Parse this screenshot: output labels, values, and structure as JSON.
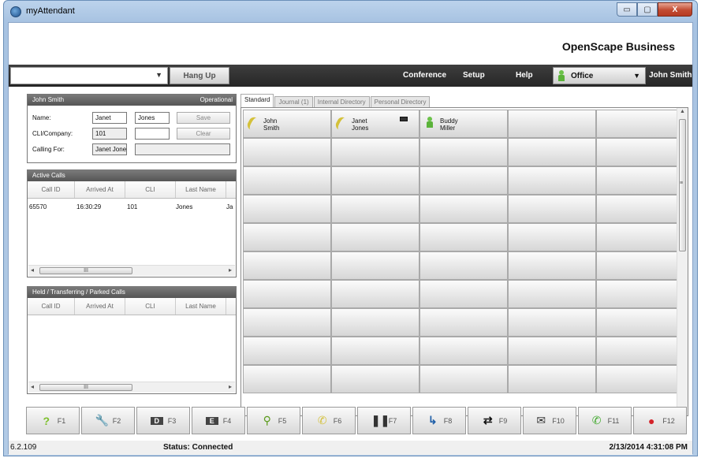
{
  "window": {
    "title": "myAttendant",
    "controls": {
      "minimize": "▭",
      "maximize": "▢",
      "close": "X"
    }
  },
  "brand": "OpenScape Business",
  "toolbar": {
    "hang_up": "Hang Up",
    "menu": [
      "Conference",
      "Setup",
      "Help"
    ],
    "presence": "Office",
    "user": "John Smith"
  },
  "caller_panel": {
    "header_name": "John Smith",
    "header_status": "Operational",
    "name_label": "Name:",
    "first_name": "Janet",
    "last_name": "Jones",
    "cli_label": "CLI/Company:",
    "cli": "101",
    "calling_for_label": "Calling For:",
    "calling_for": "Janet Jone",
    "save": "Save",
    "clear": "Clear"
  },
  "active_calls": {
    "title": "Active Calls",
    "columns": [
      "Call ID",
      "Arrived At",
      "CLI",
      "Last Name"
    ],
    "rows": [
      [
        "65570",
        "16:30:29",
        "101",
        "Jones",
        "Ja"
      ]
    ]
  },
  "held_calls": {
    "title": "Held / Transferring / Parked Calls",
    "columns": [
      "Call ID",
      "Arrived At",
      "CLI",
      "Last Name"
    ]
  },
  "tabs": [
    "Standard",
    "Journal (1)",
    "Internal Directory",
    "Personal Directory"
  ],
  "busy_lamp": [
    {
      "line1": "John",
      "line2": "Smith",
      "state": "on-call"
    },
    {
      "line1": "Janet",
      "line2": "Jones",
      "state": "on-call",
      "mail": true
    },
    {
      "line1": "Buddy",
      "line2": "Miller",
      "state": "available"
    }
  ],
  "fkeys": [
    {
      "label": "F1",
      "icon": "help-icon",
      "color": "#7cbf2a"
    },
    {
      "label": "F2",
      "icon": "wrench-icon",
      "color": "#444"
    },
    {
      "label": "F3",
      "icon": "d-key-icon",
      "color": "#444"
    },
    {
      "label": "F4",
      "icon": "e-key-icon",
      "color": "#444"
    },
    {
      "label": "F5",
      "icon": "search-icon",
      "color": "#5a9a1a"
    },
    {
      "label": "F6",
      "icon": "handset-yellow-icon",
      "color": "#d4c13a"
    },
    {
      "label": "F7",
      "icon": "pause-icon",
      "color": "#333"
    },
    {
      "label": "F8",
      "icon": "forward-icon",
      "color": "#1f5fa8"
    },
    {
      "label": "F9",
      "icon": "swap-icon",
      "color": "#111"
    },
    {
      "label": "F10",
      "icon": "mail-icon",
      "color": "#333"
    },
    {
      "label": "F11",
      "icon": "handset-green-icon",
      "color": "#3ea82a"
    },
    {
      "label": "F12",
      "icon": "record-icon",
      "color": "#d4232a"
    }
  ],
  "status": {
    "version": "6.2.109",
    "connection": "Status: Connected",
    "datetime": "2/13/2014 4:31:08 PM"
  }
}
